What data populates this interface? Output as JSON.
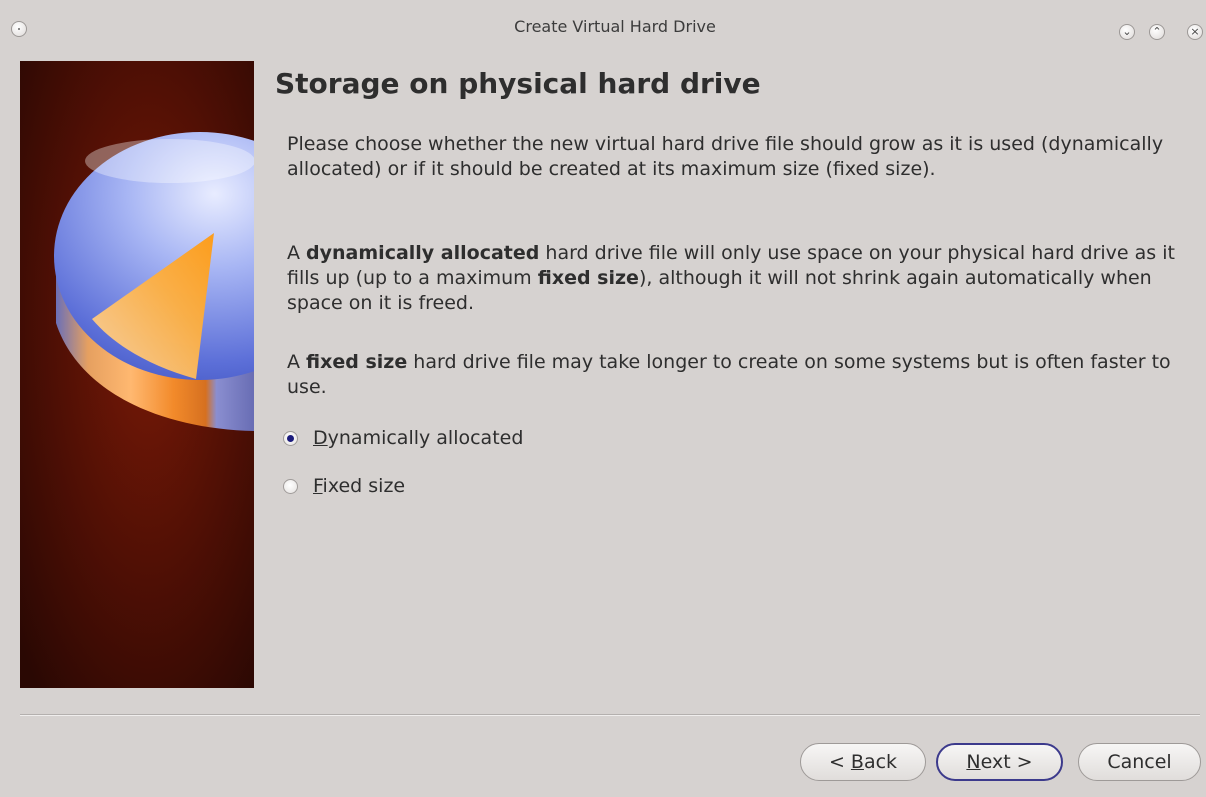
{
  "window": {
    "title": "Create Virtual Hard Drive",
    "controls": [
      "minimize",
      "maximize",
      "close"
    ]
  },
  "page": {
    "title": "Storage on physical hard drive",
    "paragraph1": "Please choose whether the new virtual hard drive file should grow as it is used (dynamically allocated) or if it should be created at its maximum size (fixed size).",
    "paragraph2": {
      "t1": "A ",
      "b1": "dynamically allocated",
      "t2": " hard drive file will only use space on your physical hard drive as it fills up (up to a maximum ",
      "b2": "fixed size",
      "t3": "), although it will not shrink again automatically when space on it is freed."
    },
    "paragraph3": {
      "t1": "A ",
      "b1": "fixed size",
      "t2": " hard drive file may take longer to create on some systems but is often faster to use."
    }
  },
  "options": [
    {
      "accel": "D",
      "rest": "ynamically allocated",
      "checked": true
    },
    {
      "accel": "F",
      "rest": "ixed size",
      "checked": false
    }
  ],
  "buttons": {
    "back": {
      "pre": "< ",
      "accel": "B",
      "rest": "ack"
    },
    "next": {
      "accel": "N",
      "rest": "ext >"
    },
    "cancel": {
      "label": "Cancel"
    }
  },
  "colors": {
    "window_bg": "#d6d2d0",
    "default_button_border": "#3c3a8c",
    "radio_dot": "#1c1c7c"
  }
}
